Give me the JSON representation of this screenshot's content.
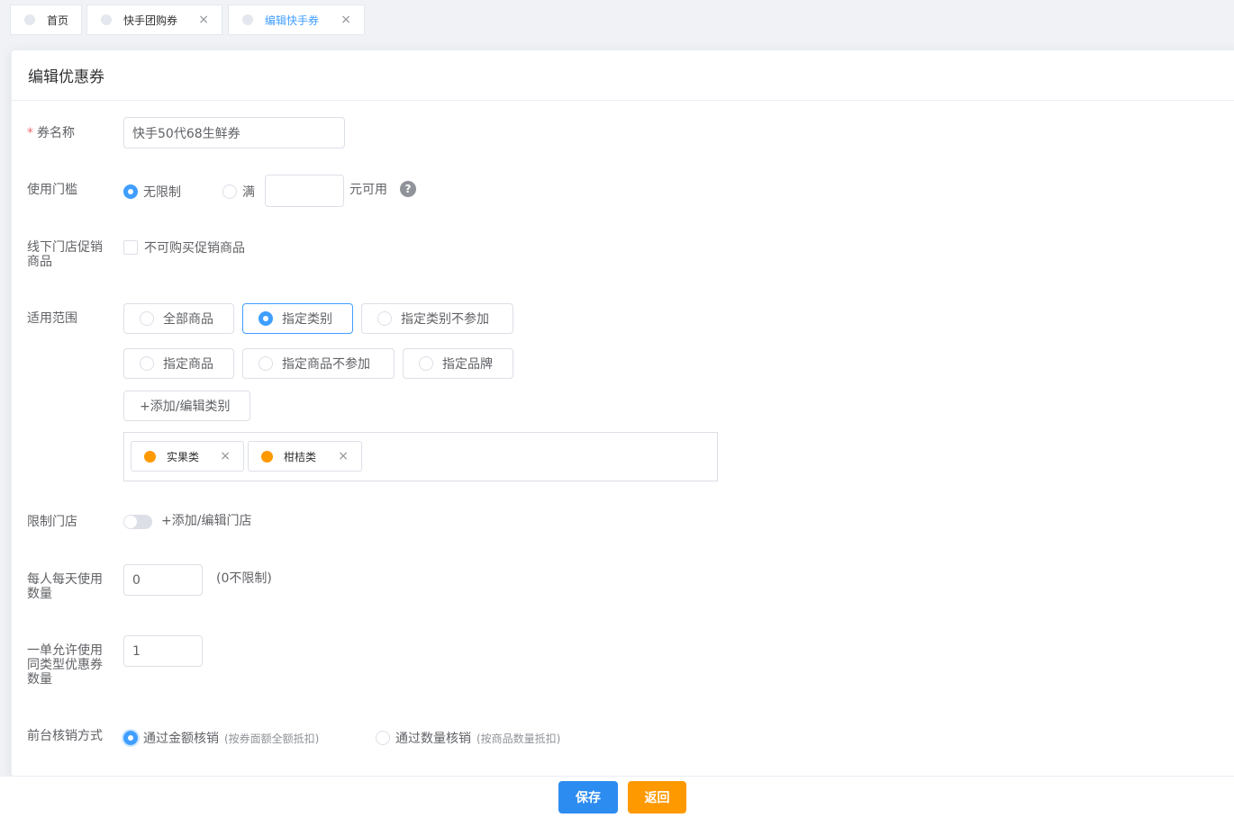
{
  "tabs": [
    {
      "label": "首页",
      "closable": false
    },
    {
      "label": "快手团购券",
      "closable": true
    },
    {
      "label": "编辑快手券",
      "closable": true,
      "active": true
    }
  ],
  "tab_close_glyph": "×",
  "card_title": "编辑优惠券",
  "form": {
    "coupon_name": {
      "label": "券名称",
      "value": "快手50代68生鲜券"
    },
    "threshold": {
      "label": "使用门槛",
      "option_unlimited": "无限制",
      "option_full": "满",
      "full_value": "",
      "suffix": "元可用",
      "selected": "无限制",
      "help_glyph": "?"
    },
    "offline_promo": {
      "label_line1": "线下门店促销",
      "label_line2": "商品",
      "checkbox_label": "不可购买促销商品",
      "checked": false
    },
    "scope": {
      "label": "适用范围",
      "options": [
        "全部商品",
        "指定类别",
        "指定类别不参加",
        "指定商品",
        "指定商品不参加",
        "指定品牌"
      ],
      "selected": "指定类别",
      "add_button": "+添加/编辑类别",
      "tags": [
        "实果类",
        "柑桔类"
      ]
    },
    "store_limit": {
      "label": "限制门店",
      "enabled": false,
      "link": "+添加/编辑门店"
    },
    "daily_limit": {
      "label_line1": "每人每天使用",
      "label_line2": "数量",
      "value": "0",
      "hint": "(0不限制)"
    },
    "order_limit": {
      "label_line1": "一单允许使用",
      "label_line2": "同类型优惠券",
      "label_line3": "数量",
      "value": "1"
    },
    "verify": {
      "label": "前台核销方式",
      "option_amount": "通过金额核销",
      "option_amount_hint": "(按券面额全额抵扣)",
      "option_quantity": "通过数量核销",
      "option_quantity_hint": "(按商品数量抵扣)",
      "selected": "通过金额核销"
    }
  },
  "footer": {
    "save_label": "保存",
    "back_label": "返回"
  },
  "colors": {
    "primary": "#409eff",
    "warning": "#ff9900",
    "danger": "#f56c6c",
    "save_button": "#2d8cf0",
    "back_button": "#ff9900"
  },
  "icons": {
    "close": "close-icon",
    "help": "question-circle-icon",
    "tab_status": "circle-dot-icon",
    "tag_status": "orange-dot-icon"
  }
}
